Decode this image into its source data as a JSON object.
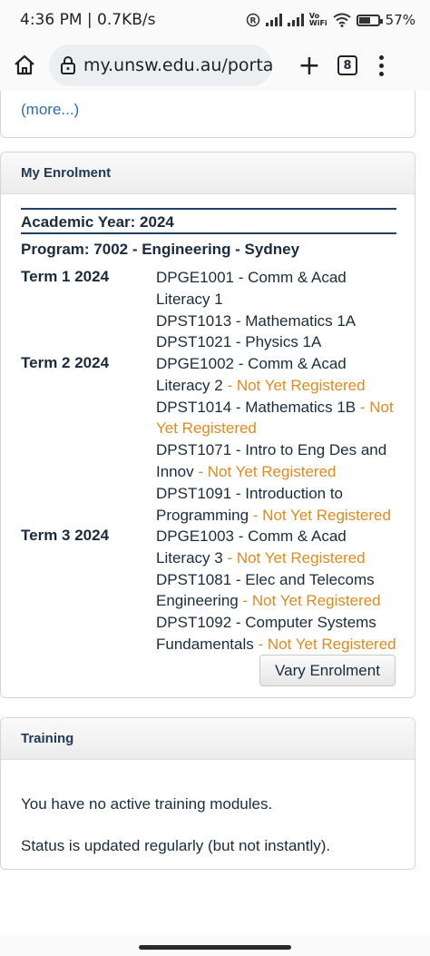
{
  "status": {
    "time_speed": "4:36 PM | 0.7KB/s",
    "vo": "Vo",
    "wifi": "WiFi",
    "battery": "57%",
    "battery_level": 0.57,
    "icons": [
      "registered-icon",
      "signal-icon",
      "signal-icon",
      "wifi-icon",
      "battery-icon"
    ]
  },
  "browser": {
    "url": "my.unsw.edu.au/portal",
    "tab_count": "8",
    "icons": [
      "home-icon",
      "lock-icon",
      "plus-icon",
      "tabs-icon",
      "more-menu-icon"
    ]
  },
  "prev_section": {
    "more_link": "(more...)"
  },
  "enrolment": {
    "title": "My Enrolment",
    "academic_year": "Academic Year: 2024",
    "program": "Program: 7002 - Engineering - Sydney",
    "terms": [
      {
        "name": "Term 1 2024",
        "courses": [
          {
            "text": "DPGE1001 - Comm & Acad Literacy 1",
            "status": ""
          },
          {
            "text": "DPST1013 - Mathematics 1A",
            "status": ""
          },
          {
            "text": "DPST1021 - Physics 1A",
            "status": ""
          }
        ]
      },
      {
        "name": "Term 2 2024",
        "courses": [
          {
            "text": "DPGE1002 - Comm & Acad Literacy 2",
            "status": "Not Yet Registered"
          },
          {
            "text": "DPST1014 - Mathematics 1B",
            "status": "Not Yet Registered"
          },
          {
            "text": "DPST1071 - Intro to Eng Des and Innov",
            "status": "Not Yet Registered"
          },
          {
            "text": "DPST1091 - Introduction to Programming",
            "status": "Not Yet Registered"
          }
        ]
      },
      {
        "name": "Term 3 2024",
        "courses": [
          {
            "text": "DPGE1003 - Comm & Acad Literacy 3",
            "status": "Not Yet Registered"
          },
          {
            "text": "DPST1081 - Elec and Telecoms Engineering",
            "status": "Not Yet Registered"
          },
          {
            "text": "DPST1092 - Computer Systems Fundamentals",
            "status": "Not Yet Registered"
          }
        ]
      }
    ],
    "vary_button": "Vary Enrolment",
    "colors": {
      "not_registered": "#e08a1e",
      "heading_rule": "#1f3f63"
    }
  },
  "training": {
    "title": "Training",
    "message": "You have no active training modules.",
    "status_note": "Status is updated regularly (but not instantly)."
  }
}
